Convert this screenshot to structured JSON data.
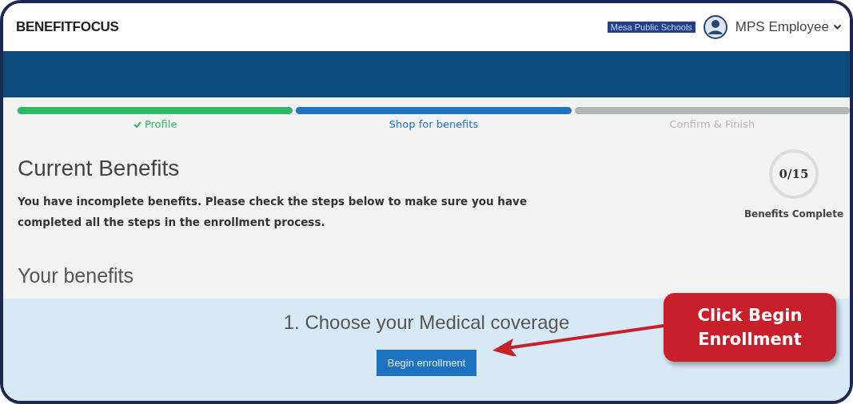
{
  "header": {
    "logo": "BENEFITFOCUS",
    "employer_link": "Mesa Public Schools",
    "user_name": "MPS Employee"
  },
  "steps": [
    {
      "label": "Profile",
      "kind": "complete"
    },
    {
      "label": "Shop for benefits",
      "kind": "current"
    },
    {
      "label": "Confirm & Finish",
      "kind": "upcoming"
    }
  ],
  "title": "Current Benefits",
  "message": "You have incomplete benefits. Please check the steps below to make sure you have completed all the steps in the enrollment process.",
  "progress": {
    "count": "0/15",
    "caption": "Benefits Complete"
  },
  "section_title": "Your benefits",
  "benefit": {
    "title": "1. Choose your Medical coverage",
    "button": "Begin enrollment"
  },
  "callout": {
    "text": "Click Begin Enrollment"
  }
}
